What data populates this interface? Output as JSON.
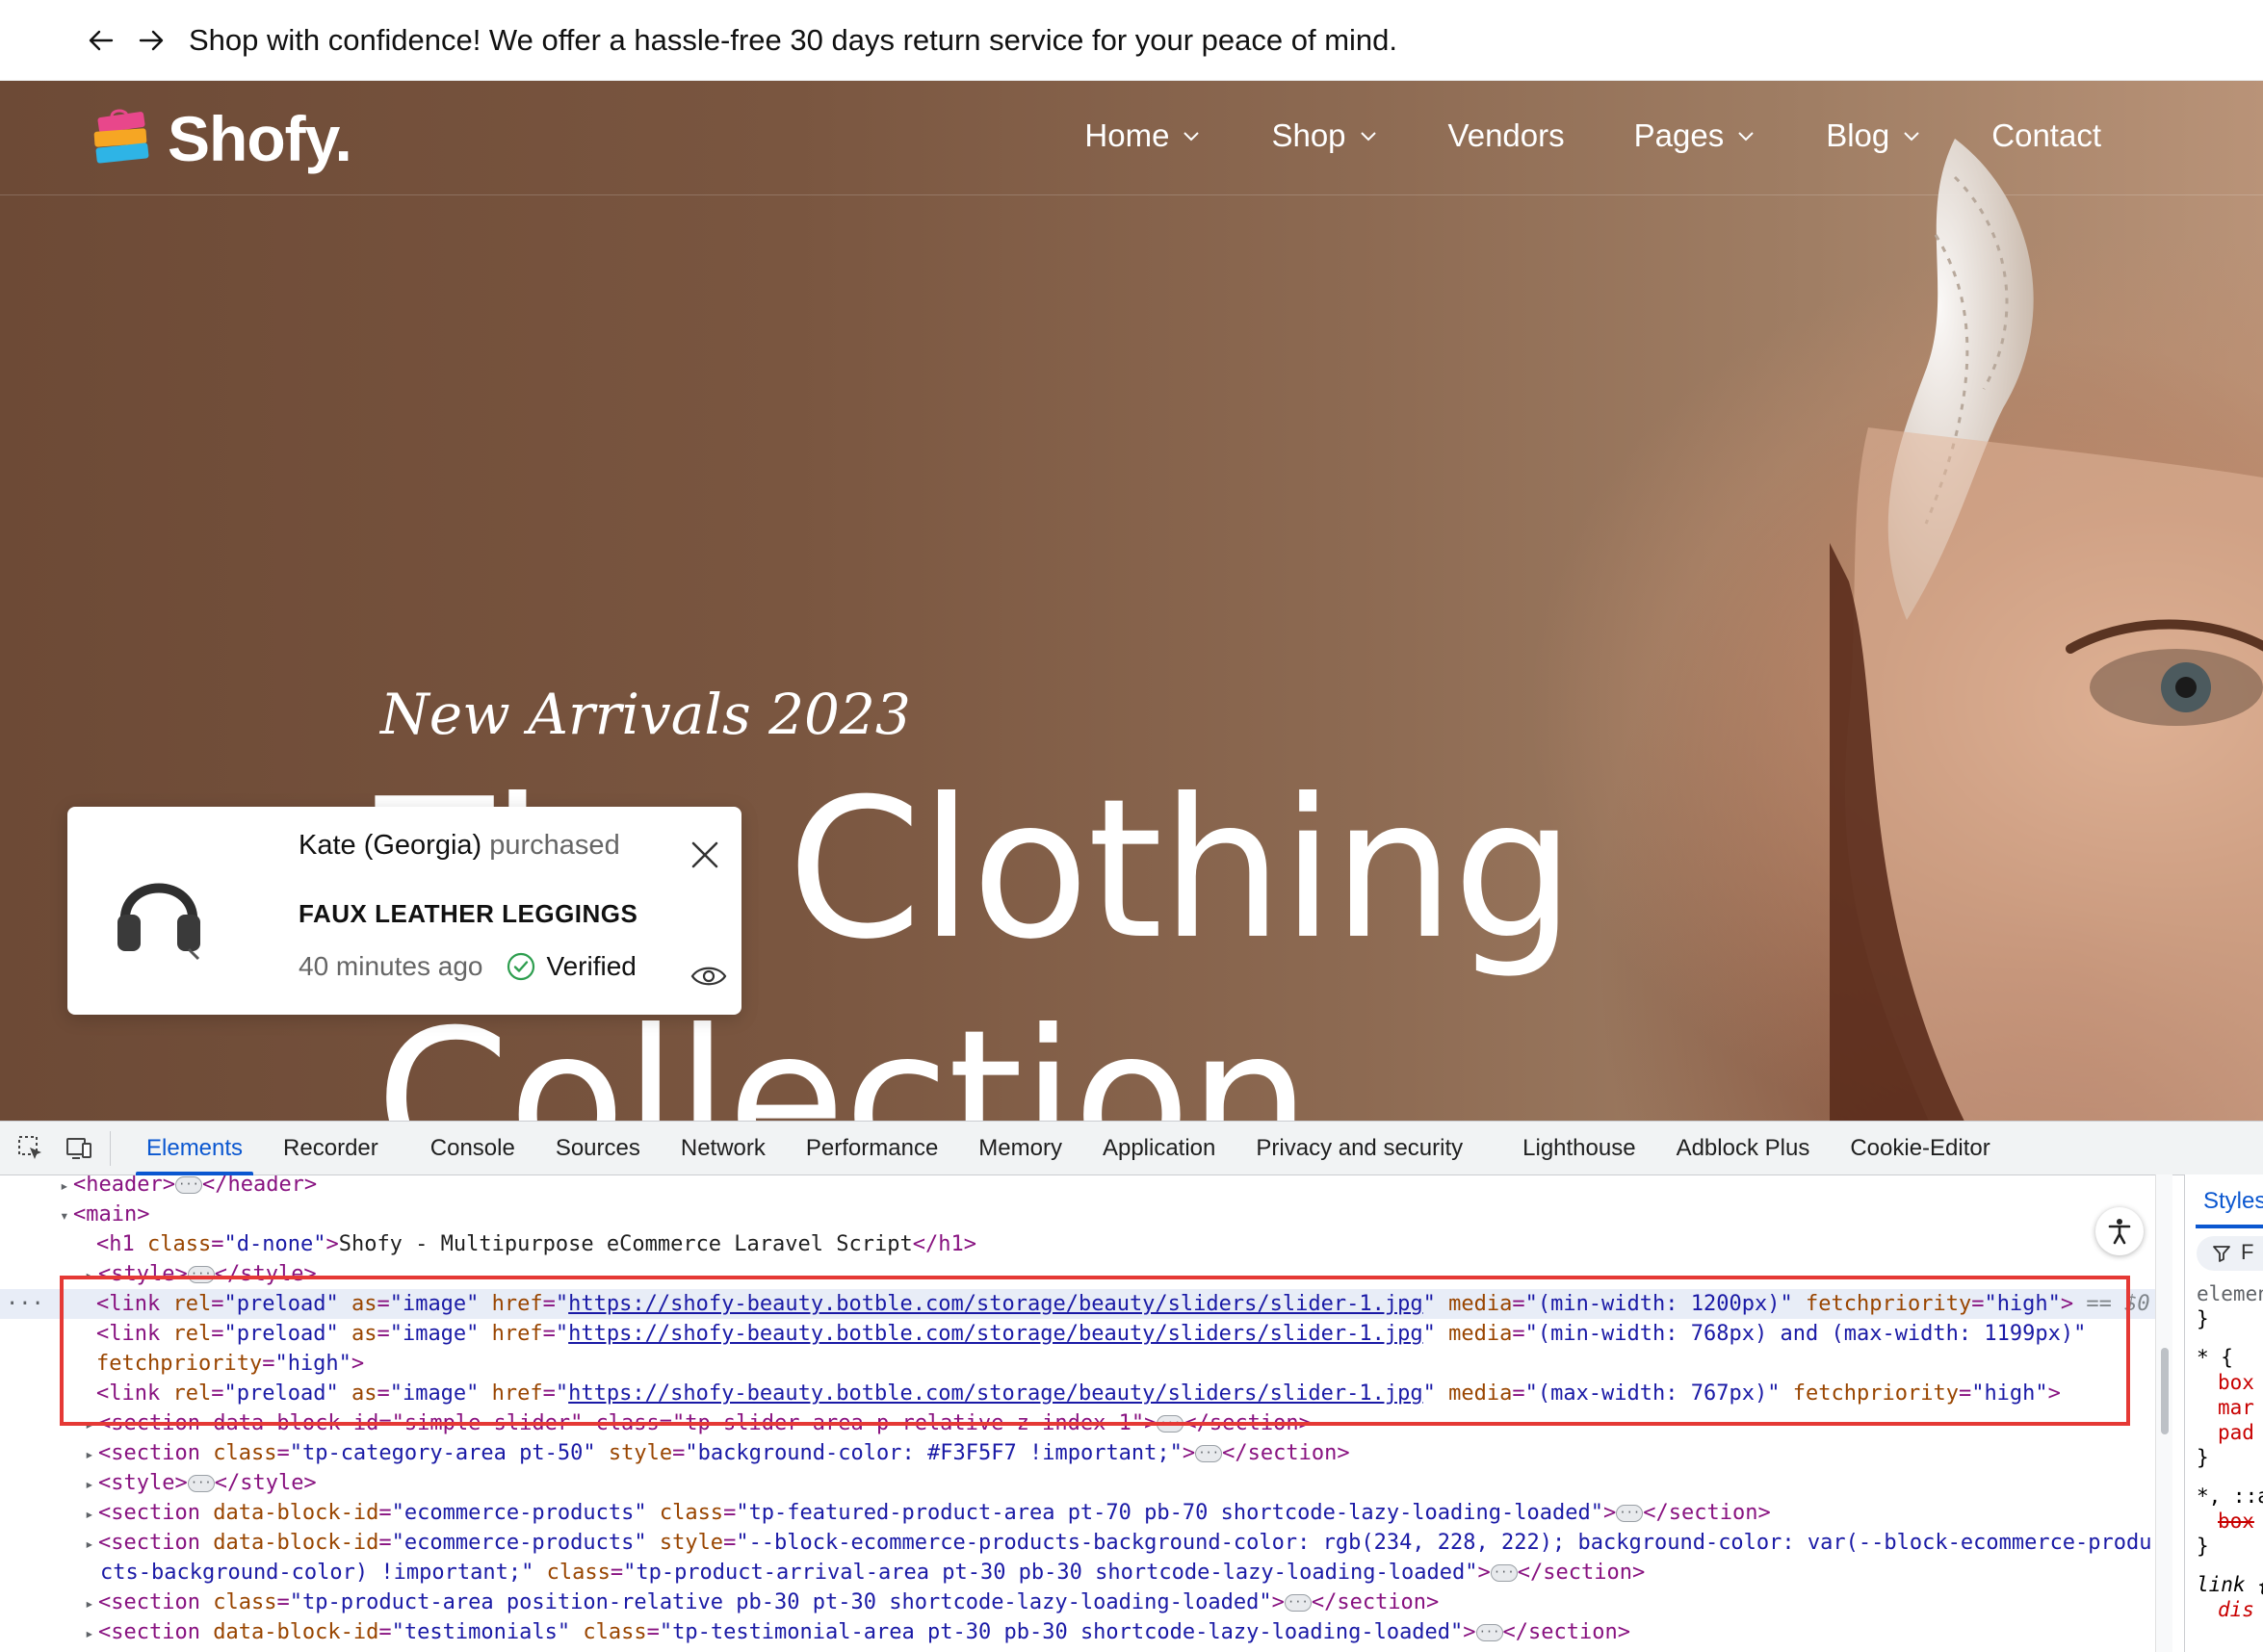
{
  "announcement": {
    "text": "Shop with confidence! We offer a hassle-free 30 days return service for your peace of mind."
  },
  "header": {
    "logo_text": "Shofy.",
    "nav": [
      {
        "label": "Home",
        "has_dropdown": true
      },
      {
        "label": "Shop",
        "has_dropdown": true
      },
      {
        "label": "Vendors",
        "has_dropdown": false
      },
      {
        "label": "Pages",
        "has_dropdown": true
      },
      {
        "label": "Blog",
        "has_dropdown": true
      },
      {
        "label": "Contact",
        "has_dropdown": false
      }
    ]
  },
  "hero": {
    "subtitle": "New Arrivals 2023",
    "headline_line1": "The Clothing",
    "headline_line2": "Collection"
  },
  "toast": {
    "buyer": "Kate (Georgia)",
    "action": "purchased",
    "product": "FAUX LEATHER LEGGINGS",
    "time": "40 minutes ago",
    "verified": "Verified"
  },
  "devtools": {
    "tabs": [
      {
        "label": "Elements",
        "active": true
      },
      {
        "label": "Recorder",
        "active": false
      },
      {
        "label": "Console",
        "active": false
      },
      {
        "label": "Sources",
        "active": false
      },
      {
        "label": "Network",
        "active": false
      },
      {
        "label": "Performance",
        "active": false
      },
      {
        "label": "Memory",
        "active": false
      },
      {
        "label": "Application",
        "active": false
      },
      {
        "label": "Privacy and security",
        "active": false
      },
      {
        "label": "Lighthouse",
        "active": false
      },
      {
        "label": "Adblock Plus",
        "active": false
      },
      {
        "label": "Cookie-Editor",
        "active": false
      }
    ],
    "styles_tab": "Styles",
    "styles_filter": "F",
    "styles_lines": [
      "element",
      "}",
      "* {",
      "box",
      "mar",
      "pad",
      "}",
      "*, ::a",
      "box",
      "}",
      "link {",
      "dis"
    ],
    "dom": {
      "header_line": "<header> … </header>",
      "main_open": "<main>",
      "h1_class": "d-none",
      "h1_text": "Shofy - Multipurpose eCommerce Laravel Script",
      "link_href": "https://shofy-beauty.botble.com/storage/beauty/sliders/slider-1.jpg",
      "link1_media": "(min-width: 1200px)",
      "link2_media": "(min-width: 768px) and (max-width: 1199px)",
      "link3_media": "(max-width: 767px)",
      "fetchpriority": "high",
      "selected_marker": "== $0",
      "section1": "<section data-block-id=\"simple-slider\" class=\"tp-slider-area p-relative z-index-1\">",
      "section2_class": "tp-category-area pt-50",
      "section2_style": "background-color: #F3F5F7 !important;",
      "section3_block": "ecommerce-products",
      "section3_class": "tp-featured-product-area pt-70 pb-70 shortcode-lazy-loading-loaded",
      "section4_block": "ecommerce-products",
      "section4_style_a": "--block-ecommerce-products-background-color: rgb(234, 228, 222); background-color: var(--block-ecommerce-produ",
      "section4_style_b": "cts-background-color) !important;",
      "section4_class": "tp-product-arrival-area pt-30 pb-30 shortcode-lazy-loading-loaded",
      "section5_class": "tp-product-area position-relative pb-30 pt-30 shortcode-lazy-loading-loaded",
      "section6_block": "testimonials",
      "section6_class": "tp-testimonial-area pt-30 pb-30 shortcode-lazy-loading-loaded"
    }
  },
  "colors": {
    "accent": "#0b57d0",
    "highlight": "#e53935",
    "verified": "#2e9e4f"
  }
}
